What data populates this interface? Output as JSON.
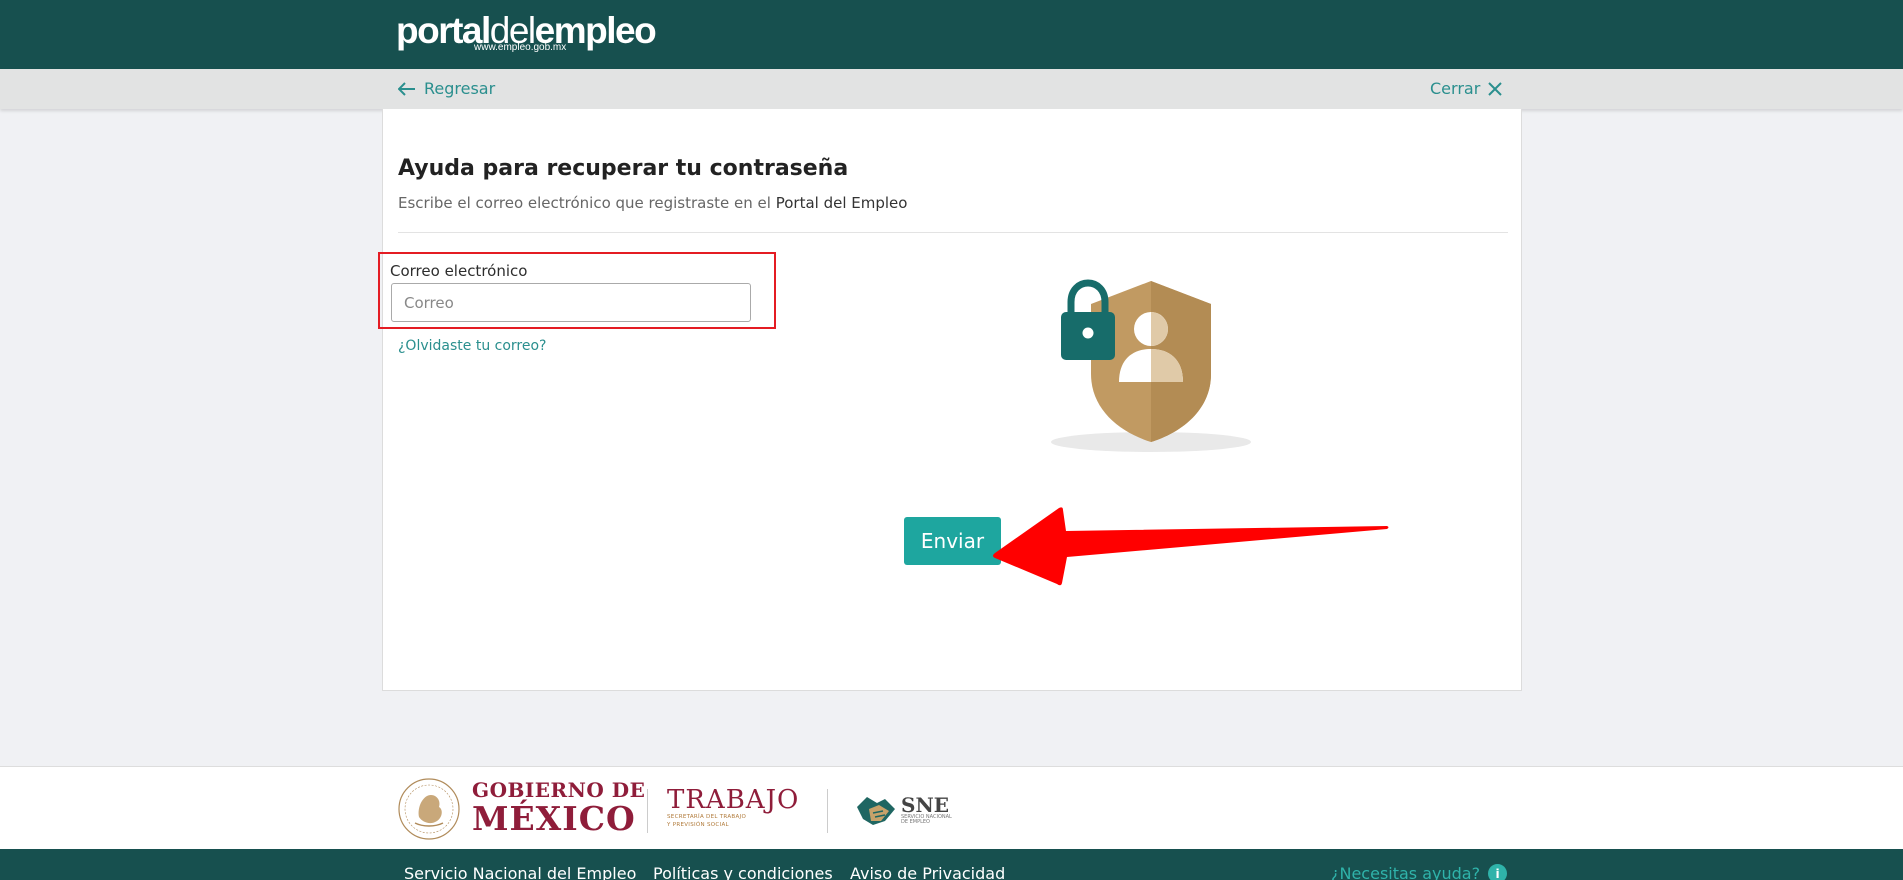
{
  "header": {
    "logo_bold_1": "portal",
    "logo_thin": "del",
    "logo_bold_2": "empleo",
    "logo_url": "www.empleo.gob.mx"
  },
  "subnav": {
    "back_label": "Regresar",
    "close_label": "Cerrar"
  },
  "form": {
    "title": "Ayuda para recuperar tu contraseña",
    "subtitle_prefix": "Escribe el correo electrónico que registraste en el ",
    "subtitle_strong": "Portal del Empleo",
    "email_label": "Correo electrónico",
    "email_placeholder": "Correo",
    "email_value": "",
    "forgot_link": "¿Olvidaste tu correo?",
    "submit_label": "Enviar"
  },
  "footer": {
    "gob_line1": "GOBIERNO DE",
    "gob_line2": "MÉXICO",
    "trabajo_title": "TRABAJO",
    "trabajo_sub1": "SECRETARÍA DEL TRABAJO",
    "trabajo_sub2": "Y PREVISIÓN SOCIAL",
    "sne_title": "SNE",
    "sne_sub1": "SERVICIO NACIONAL",
    "sne_sub2": "DE EMPLEO",
    "links": [
      "Servicio Nacional del Empleo",
      "Políticas y condiciones",
      "Aviso de Privacidad"
    ],
    "help_label": "¿Necesitas ayuda?",
    "help_icon": "i"
  },
  "colors": {
    "header_bg": "#17504f",
    "accent": "#1ea69f",
    "link": "#2a8f8e",
    "highlight_red": "#e41c23",
    "government_maroon": "#8f1d3a"
  }
}
